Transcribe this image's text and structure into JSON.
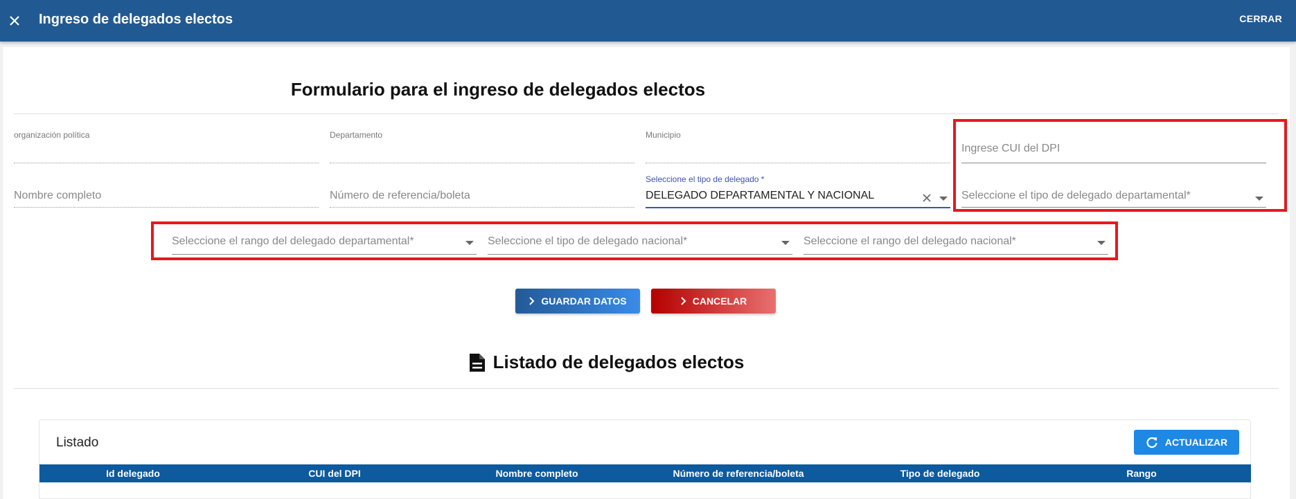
{
  "appbar": {
    "title": "Ingreso de delegados electos",
    "close_label": "CERRAR"
  },
  "form": {
    "heading": "Formulario para el ingreso de delegados electos",
    "org_label": "organización política",
    "depto_label": "Departamento",
    "muni_label": "Municipio",
    "cui_placeholder": "Ingrese CUI del DPI",
    "nombre_placeholder": "Nombre completo",
    "referencia_placeholder": "Número de referencia/boleta",
    "tipo_label": "Seleccione el tipo de delegado *",
    "tipo_value": "DELEGADO DEPARTAMENTAL Y NACIONAL",
    "tipo_depto_placeholder": "Seleccione el tipo de delegado departamental*",
    "rango_depto_placeholder": "Seleccione el rango del delegado departamental*",
    "tipo_nac_placeholder": "Seleccione el tipo de delegado nacional*",
    "rango_nac_placeholder": "Seleccione el rango del delegado nacional*"
  },
  "buttons": {
    "save": "GUARDAR DATOS",
    "cancel": "CANCELAR",
    "refresh": "ACTUALIZAR"
  },
  "list": {
    "heading": "Listado de delegados electos",
    "panel_title": "Listado",
    "columns": [
      "Id delegado",
      "CUI del DPI",
      "Nombre completo",
      "Número de referencia/boleta",
      "Tipo de delegado",
      "Rango"
    ]
  },
  "colors": {
    "appbar": "#215a93",
    "highlight": "#e8171d",
    "accent": "#3f51b5",
    "table_header": "#0d5a9e",
    "refresh": "#1e88e5"
  }
}
